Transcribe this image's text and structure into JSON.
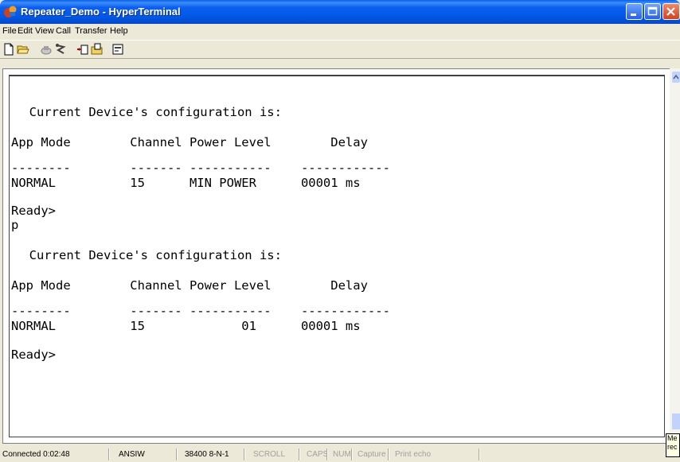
{
  "window": {
    "title": "Repeater_Demo - HyperTerminal"
  },
  "menu": {
    "items": [
      "File",
      "Edit",
      "View",
      "Call",
      "Transfer",
      "Help"
    ]
  },
  "toolbar": {
    "icons": [
      "new-icon",
      "open-icon",
      "connect-icon",
      "disconnect-icon",
      "send-icon",
      "receive-icon",
      "properties-icon"
    ]
  },
  "terminal": {
    "lines": [
      "  Current Device's configuration is:",
      "App Mode        Channel Power Level        Delay",
      "--------        ------- -----------    ------------",
      "NORMAL          15      MIN POWER      00001 ms",
      "Ready>",
      "p",
      "  Current Device's configuration is:",
      "App Mode        Channel Power Level        Delay",
      "--------        ------- -----------    ------------",
      "NORMAL          15             01      00001 ms",
      "Ready>"
    ]
  },
  "statusbar": {
    "connected": "Connected 0:02:48",
    "emulation": "ANSIW",
    "settings": "38400 8-N-1",
    "scroll": "SCROLL",
    "caps": "CAPS",
    "num": "NUM",
    "capture": "Capture",
    "print_echo": "Print echo"
  },
  "popup": {
    "line1": "Me",
    "line2": "rec"
  }
}
